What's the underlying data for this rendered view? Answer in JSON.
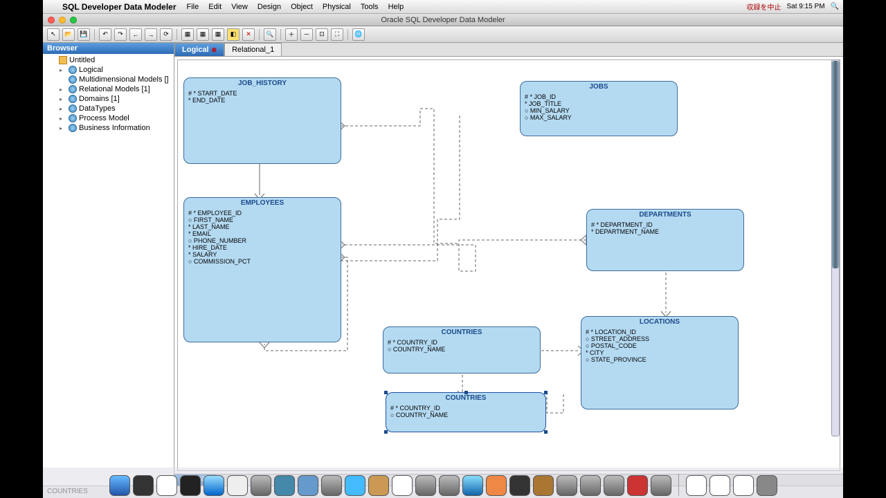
{
  "menubar": {
    "app_title": "SQL Developer Data Modeler",
    "items": [
      "File",
      "Edit",
      "View",
      "Design",
      "Object",
      "Physical",
      "Tools",
      "Help"
    ],
    "clock": "Sat 9:15 PM",
    "jp_status": "収録を中止"
  },
  "window": {
    "title": "Oracle SQL Developer Data Modeler"
  },
  "browser": {
    "header": "Browser",
    "items": [
      {
        "label": "Untitled",
        "indent": 0,
        "exp": "",
        "icon": "folder"
      },
      {
        "label": "Logical",
        "indent": 1,
        "exp": "▸",
        "icon": "node"
      },
      {
        "label": "Multidimensional Models []",
        "indent": 1,
        "exp": "",
        "icon": "node"
      },
      {
        "label": "Relational Models [1]",
        "indent": 1,
        "exp": "▸",
        "icon": "node"
      },
      {
        "label": "Domains [1]",
        "indent": 1,
        "exp": "▸",
        "icon": "node"
      },
      {
        "label": "DataTypes",
        "indent": 1,
        "exp": "▸",
        "icon": "node"
      },
      {
        "label": "Process Model",
        "indent": 1,
        "exp": "▸",
        "icon": "node"
      },
      {
        "label": "Business Information",
        "indent": 1,
        "exp": "▸",
        "icon": "node"
      }
    ]
  },
  "tabs": {
    "active": "Logical",
    "other": "Relational_1"
  },
  "bottom_tab": "Logical",
  "statusbar": "COUNTRIES",
  "entities": {
    "job_history": {
      "title": "JOB_HISTORY",
      "attrs": [
        "# * START_DATE",
        "* END_DATE"
      ]
    },
    "jobs": {
      "title": "JOBS",
      "attrs": [
        "# * JOB_ID",
        "* JOB_TITLE",
        "○ MIN_SALARY",
        "○ MAX_SALARY"
      ]
    },
    "employees": {
      "title": "EMPLOYEES",
      "attrs": [
        "# * EMPLOYEE_ID",
        "○ FIRST_NAME",
        "* LAST_NAME",
        "* EMAIL",
        "○ PHONE_NUMBER",
        "* HIRE_DATE",
        "* SALARY",
        "○ COMMISSION_PCT"
      ]
    },
    "departments": {
      "title": "DEPARTMENTS",
      "attrs": [
        "# * DEPARTMENT_ID",
        "* DEPARTMENT_NAME"
      ]
    },
    "countries1": {
      "title": "COUNTRIES",
      "attrs": [
        "# * COUNTRY_ID",
        "○ COUNTRY_NAME"
      ]
    },
    "locations": {
      "title": "LOCATIONS",
      "attrs": [
        "# * LOCATION_ID",
        "○ STREET_ADDRESS",
        "○ POSTAL_CODE",
        "* CITY",
        "○ STATE_PROVINCE"
      ]
    },
    "countries2": {
      "title": "COUNTRIES",
      "attrs": [
        "# * COUNTRY_ID",
        "○ COUNTRY_NAME"
      ]
    }
  }
}
